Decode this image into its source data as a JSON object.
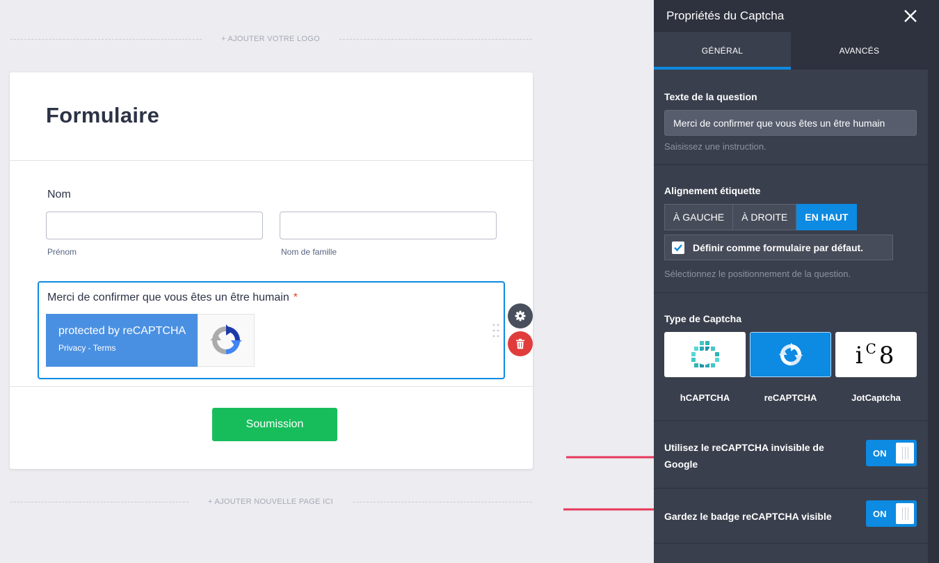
{
  "canvas": {
    "add_logo": "+ AJOUTER VOTRE LOGO",
    "add_page": "+ AJOUTER NOUVELLE PAGE ICI",
    "form": {
      "title": "Formulaire",
      "name_label": "Nom",
      "first_name_sublabel": "Prénom",
      "last_name_sublabel": "Nom de famille",
      "first_name_value": "",
      "last_name_value": "",
      "captcha_question": "Merci de confirmer que vous êtes un être humain",
      "required_mark": "*",
      "recaptcha_badge": {
        "main_text": "protected by reCAPTCHA",
        "links_text": "Privacy - Terms"
      },
      "submit_label": "Soumission"
    },
    "tool_icons": [
      "gear-icon",
      "trash-icon",
      "drag-handle-icon"
    ]
  },
  "panel": {
    "title": "Propriétés du Captcha",
    "tabs": [
      {
        "label": "GÉNÉRAL",
        "active": true
      },
      {
        "label": "AVANCÉS",
        "active": false
      }
    ],
    "question_text": {
      "label": "Texte de la question",
      "value": "Merci de confirmer que vous êtes un être humain",
      "hint": "Saisissez une instruction."
    },
    "label_alignment": {
      "label": "Alignement étiquette",
      "options": [
        "À GAUCHE",
        "À DROITE",
        "EN HAUT"
      ],
      "selected": "EN HAUT",
      "default_checkbox_label": "Définir comme formulaire par défaut.",
      "default_checked": true,
      "hint": "Sélectionnez le positionnement de la question."
    },
    "captcha_type": {
      "label": "Type de Captcha",
      "options": [
        {
          "name": "hCAPTCHA",
          "icon": "hcaptcha-logo-icon"
        },
        {
          "name": "reCAPTCHA",
          "icon": "recaptcha-logo-icon"
        },
        {
          "name": "JotCaptcha",
          "icon": "jotcaptcha-logo-icon"
        }
      ],
      "selected": "reCAPTCHA",
      "jot_logo_text": "iC8"
    },
    "invisible_recaptcha": {
      "label": "Utilisez le reCAPTCHA invisible de Google",
      "state": "ON"
    },
    "keep_badge_visible": {
      "label": "Gardez le badge reCAPTCHA visible",
      "state": "ON"
    }
  },
  "colors": {
    "accent": "#0d8ae1",
    "submit": "#18bd5b",
    "panel_bg": "#3a3f4d",
    "recaptcha_blue": "#4a90e2",
    "arrow": "#e8385a",
    "delete": "#e03c3c"
  }
}
